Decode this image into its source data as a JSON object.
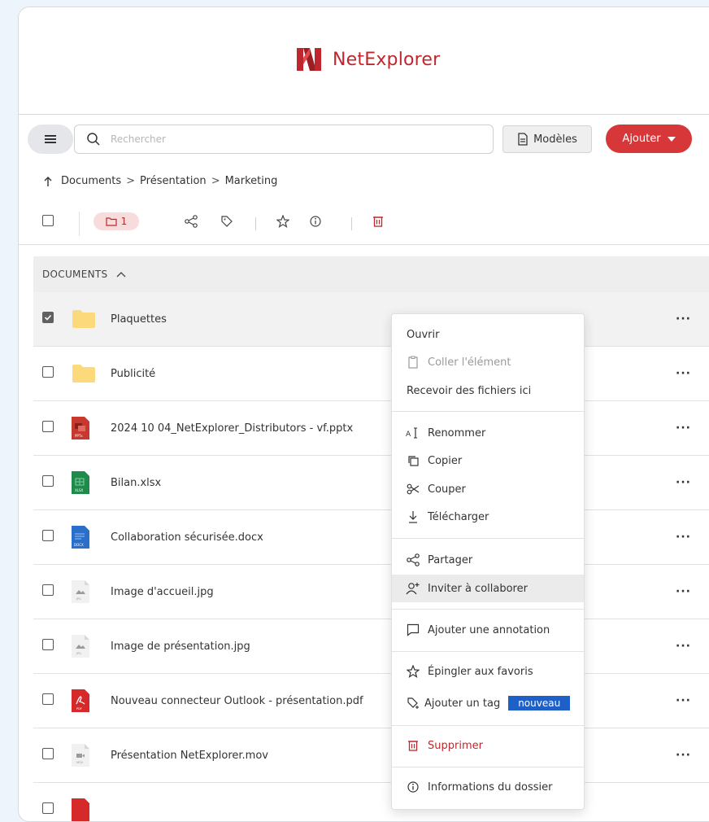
{
  "app": {
    "name": "NetExplorer",
    "brand_color": "#c0262d",
    "accent_add": "#d8373a"
  },
  "search": {
    "placeholder": "Rechercher"
  },
  "toolbar": {
    "models_label": "Modèles",
    "add_label": "Ajouter",
    "selected_folders_count": "1"
  },
  "breadcrumb": {
    "items": [
      "Documents",
      "Présentation",
      "Marketing"
    ]
  },
  "section": {
    "title": "DOCUMENTS"
  },
  "files": [
    {
      "name": "Plaquettes",
      "type": "folder",
      "selected": true
    },
    {
      "name": "Publicité",
      "type": "folder",
      "selected": false
    },
    {
      "name": "2024 10 04_NetExplorer_Distributors - vf.pptx",
      "type": "pptx",
      "selected": false
    },
    {
      "name": "Bilan.xlsx",
      "type": "xlsx",
      "selected": false
    },
    {
      "name": "Collaboration sécurisée.docx",
      "type": "docx",
      "selected": false
    },
    {
      "name": "Image d'accueil.jpg",
      "type": "jpg",
      "selected": false
    },
    {
      "name": "Image de présentation.jpg",
      "type": "jpg",
      "selected": false
    },
    {
      "name": "Nouveau connecteur Outlook - présentation.pdf",
      "type": "pdf",
      "selected": false
    },
    {
      "name": "Présentation NetExplorer.mov",
      "type": "mov",
      "selected": false
    }
  ],
  "row_more": "···",
  "context_menu": {
    "open": "Ouvrir",
    "paste": "Coller l'élément",
    "receive": "Recevoir des fichiers ici",
    "rename": "Renommer",
    "copy": "Copier",
    "cut": "Couper",
    "download": "Télécharger",
    "share": "Partager",
    "invite": "Inviter à collaborer",
    "annotate": "Ajouter une annotation",
    "pin": "Épingler aux favoris",
    "tag": "Ajouter un tag",
    "tag_badge": "nouveau",
    "delete": "Supprimer",
    "info": "Informations du dossier"
  }
}
